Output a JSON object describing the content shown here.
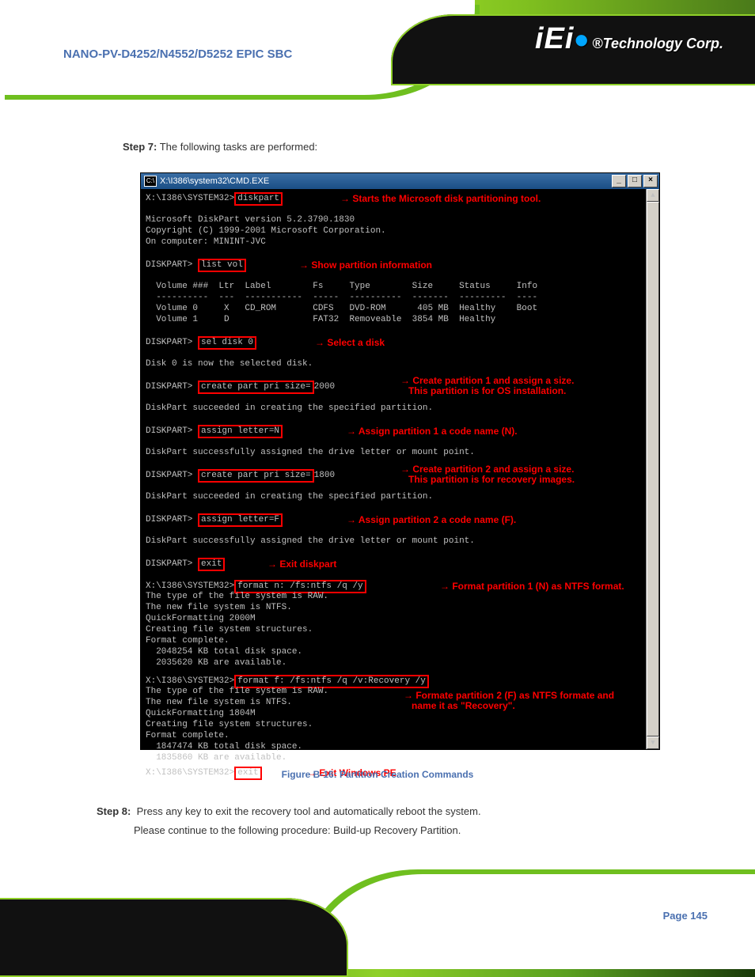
{
  "header": {
    "logo": "iEi",
    "logo_tag": "®Technology Corp.",
    "doc_title": "NANO-PV-D4252/N4552/D5252 EPIC SBC"
  },
  "step7": {
    "label": "Step 7:",
    "text": "The following tasks are performed:"
  },
  "console": {
    "title": "X:\\I386\\system32\\CMD.EXE",
    "lines": {
      "l01_prompt": "X:\\I386\\SYSTEM32>",
      "l01_cmd": "diskpart",
      "l02": "Microsoft DiskPart version 5.2.3790.1830",
      "l03": "Copyright (C) 1999-2001 Microsoft Corporation.",
      "l04": "On computer: MININT-JVC",
      "l05_prompt": "DISKPART> ",
      "l05_cmd": "list vol",
      "l06": "  Volume ###  Ltr  Label        Fs     Type        Size     Status     Info",
      "l07": "  ----------  ---  -----------  -----  ----------  -------  ---------  ----",
      "l08": "  Volume 0     X   CD_ROM       CDFS   DVD-ROM      405 MB  Healthy    Boot",
      "l09": "  Volume 1     D                FAT32  Removeable  3854 MB  Healthy",
      "l10_prompt": "DISKPART> ",
      "l10_cmd": "sel disk 0",
      "l11": "Disk 0 is now the selected disk.",
      "l12_prompt": "DISKPART> ",
      "l12_cmd": "create part pri size=",
      "l12_val": "2000",
      "l13": "DiskPart succeeded in creating the specified partition.",
      "l14_prompt": "DISKPART> ",
      "l14_cmd": "assign letter=N",
      "l15": "DiskPart successfully assigned the drive letter or mount point.",
      "l16_prompt": "DISKPART> ",
      "l16_cmd": "create part pri size=",
      "l16_val": "1800",
      "l17": "DiskPart succeeded in creating the specified partition.",
      "l18_prompt": "DISKPART> ",
      "l18_cmd": "assign letter=F",
      "l19": "DiskPart successfully assigned the drive letter or mount point.",
      "l20_prompt": "DISKPART> ",
      "l20_cmd": "exit",
      "l21_prompt": "X:\\I386\\SYSTEM32>",
      "l21_cmd": "format n: /fs:ntfs /q /y",
      "l22": "The type of the file system is RAW.",
      "l23": "The new file system is NTFS.",
      "l24": "QuickFormatting 2000M",
      "l25": "Creating file system structures.",
      "l26": "Format complete.",
      "l27": "  2048254 KB total disk space.",
      "l28": "  2035620 KB are available.",
      "l29_prompt": "X:\\I386\\SYSTEM32>",
      "l29_cmd": "format f: /fs:ntfs /q /v:Recovery /y",
      "l30": "The type of the file system is RAW.",
      "l31": "The new file system is NTFS.",
      "l32": "QuickFormatting 1804M",
      "l33": "Creating file system structures.",
      "l34": "Format complete.",
      "l35": "  1847474 KB total disk space.",
      "l36": "  1835860 KB are available.",
      "l37_prompt": "X:\\I386\\SYSTEM32>",
      "l37_cmd": "exit"
    },
    "annotations": {
      "a1": "Starts the Microsoft disk partitioning tool.",
      "a2": "Show partition information",
      "a3": "Select a disk",
      "a4a": "Create partition 1 and assign a size.",
      "a4b": "This partition is for OS installation.",
      "a5": "Assign partition 1 a code name (N).",
      "a6a": "Create partition 2 and assign a size.",
      "a6b": "This partition is for recovery images.",
      "a7": "Assign partition 2 a code name (F).",
      "a8": "Exit diskpart",
      "a9": "Format partition 1 (N) as NTFS format.",
      "a10a": "Formate partition 2 (F) as NTFS formate and",
      "a10b": "name it as \"Recovery\".",
      "a11": "Exit Windows PE"
    }
  },
  "figure_caption": "Figure B-16: Partition Creation Commands",
  "step8": {
    "label": "Step 8:",
    "line1": "Press any key to exit the recovery tool and automatically reboot the system.",
    "line2": "Please continue to the following procedure: Build-up Recovery Partition."
  },
  "page_number": "Page 145"
}
